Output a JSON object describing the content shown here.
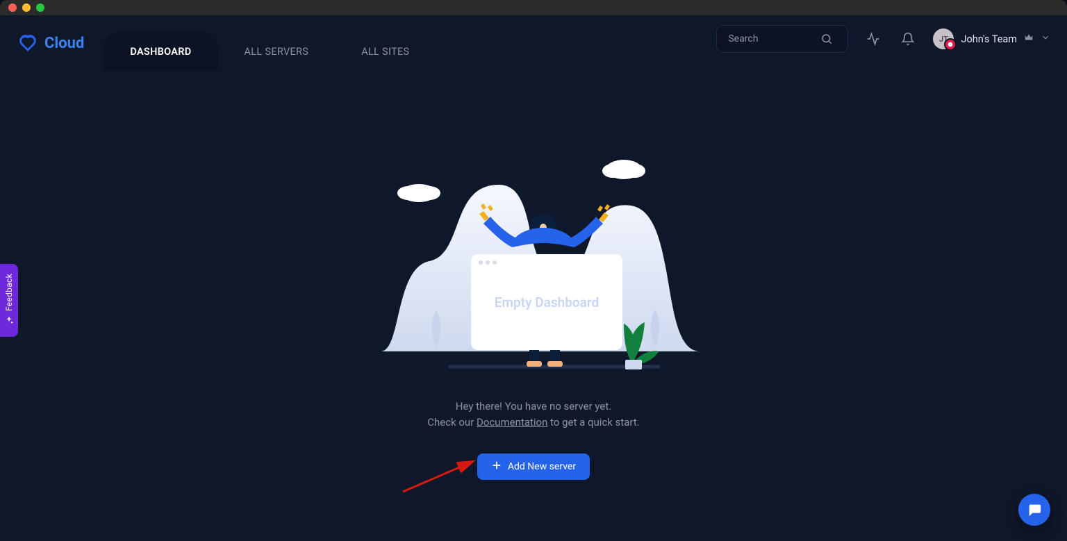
{
  "brand": {
    "name": "Cloud"
  },
  "nav": {
    "tabs": [
      {
        "label": "DASHBOARD",
        "active": true
      },
      {
        "label": "ALL SERVERS",
        "active": false
      },
      {
        "label": "ALL SITES",
        "active": false
      }
    ]
  },
  "search": {
    "placeholder": "Search"
  },
  "team": {
    "avatar_initials": "JT",
    "name": "John's Team"
  },
  "feedback": {
    "label": "Feedback"
  },
  "empty_state": {
    "browser_title": "Empty Dashboard",
    "line1": "Hey there! You have no server yet.",
    "line2_pre": "Check our ",
    "line2_link": "Documentation",
    "line2_post": " to get a quick start."
  },
  "actions": {
    "add_server": "Add New server"
  },
  "colors": {
    "accent": "#2563eb",
    "accent_bright": "#3b82f6",
    "violet": "#6d28d9",
    "arrow": "#d61a12"
  }
}
